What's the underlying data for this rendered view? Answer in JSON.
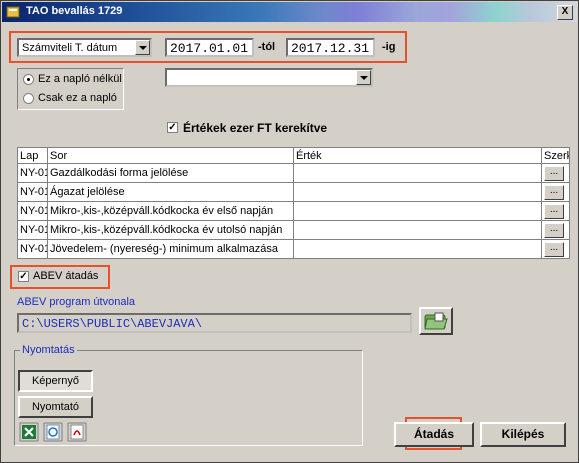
{
  "window": {
    "title": "TAO bevallás 1729",
    "close_label": "X"
  },
  "date_filter": {
    "type_selected": "Számviteli T. dátum",
    "from": "2017.01.01",
    "from_suffix": "-tól",
    "to": "2017.12.31",
    "to_suffix": "-ig"
  },
  "journal_options": [
    {
      "label": "Ez a napló nélkül",
      "checked": true
    },
    {
      "label": "Csak ez a napló",
      "checked": false
    }
  ],
  "journal_select": {
    "value": ""
  },
  "round_thousands": {
    "label": "Értékek ezer FT kerekítve",
    "checked": true
  },
  "table": {
    "headers": [
      "Lap",
      "Sor",
      "Érték",
      "Szerk"
    ],
    "rows": [
      {
        "lap": "NY-01",
        "sor": "Gazdálkodási forma jelölése",
        "ertek": "",
        "btn": "..."
      },
      {
        "lap": "NY-01",
        "sor": "Ágazat jelölése",
        "ertek": "",
        "btn": "..."
      },
      {
        "lap": "NY-01",
        "sor": "Mikro-,kis-,középváll.kódkocka év első napján",
        "ertek": "",
        "btn": "..."
      },
      {
        "lap": "NY-01",
        "sor": "Mikro-,kis-,középváll.kódkocka év utolsó napján",
        "ertek": "",
        "btn": "..."
      },
      {
        "lap": "NY-01",
        "sor": "Jövedelem- (nyereség-) minimum alkalmazása",
        "ertek": "",
        "btn": "..."
      }
    ]
  },
  "abev": {
    "checkbox_label": "ABEV átadás",
    "checked": true,
    "path_label": "ABEV program útvonala",
    "path_value": "C:\\USERS\\PUBLIC\\ABEVJAVA\\",
    "folder_icon": "folder-open-icon"
  },
  "print": {
    "legend": "Nyomtatás",
    "screen_label": "Képernyő",
    "printer_label": "Nyomtató",
    "icons": [
      "excel-icon",
      "refresh-icon",
      "pdf-icon"
    ]
  },
  "actions": {
    "submit_label": "Átadás",
    "exit_label": "Kilépés"
  },
  "colors": {
    "highlight_red": "#e8502c",
    "link_blue": "#1a2dbe",
    "title_blue": "#0a246a"
  }
}
